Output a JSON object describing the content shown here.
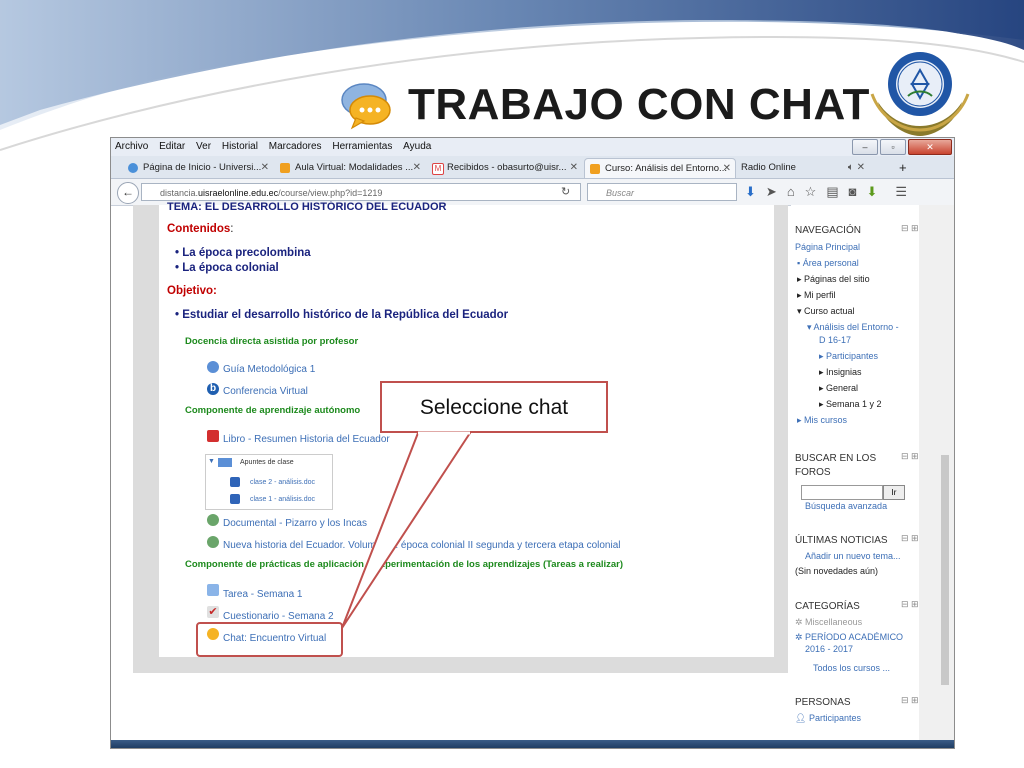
{
  "slide": {
    "title": "TRABAJO CON CHAT"
  },
  "colors": {
    "accent_blue": "#1565c0",
    "callout_border": "#c0504d",
    "heading_red": "#c00000",
    "heading_navy": "#1a237e",
    "section_green": "#1d8a1d",
    "link_blue": "#3d6fb6"
  },
  "browser": {
    "menu": [
      "Archivo",
      "Editar",
      "Ver",
      "Historial",
      "Marcadores",
      "Herramientas",
      "Ayuda"
    ],
    "tabs": [
      {
        "label": "Página de Inicio - Universi...",
        "icon": "globe-icon"
      },
      {
        "label": "Aula Virtual: Modalidades ...",
        "icon": "moodle-icon"
      },
      {
        "label": "Recibidos - obasurto@uisr...",
        "icon": "gmail-icon"
      },
      {
        "label": "Curso: Análisis del Entorno...",
        "icon": "moodle-icon",
        "active": true
      },
      {
        "label": "Radio Online",
        "icon": "speaker-icon"
      }
    ],
    "url_prefix": "distancia.",
    "url_domain": "uisraelonline.edu.ec",
    "url_path": "/course/view.php?id=1219",
    "search_placeholder": "Buscar"
  },
  "course": {
    "topic_cut": "TEMA: EL DESARROLLO HISTÓRICO DEL ECUADOR",
    "contents_label": "Contenidos",
    "contents": [
      "La época precolombina",
      "La época colonial"
    ],
    "objective_label": "Objetivo:",
    "objective": "Estudiar el desarrollo histórico de la República del Ecuador",
    "section1": "Docencia directa asistida por profesor",
    "section1_items": [
      "Guía Metodológica 1",
      "Conferencia Virtual"
    ],
    "section2": "Componente  de aprendizaje autónomo",
    "section2_items": [
      "Libro - Resumen Historia del Ecuador"
    ],
    "folder": {
      "name": "Apuntes de clase",
      "files": [
        "clase 2 - análisis.doc",
        "clase 1 - análisis.doc"
      ]
    },
    "section2_more": [
      "Documental - Pizarro y los Incas",
      "Nueva historia del Ecuador. Volumen 4: época colonial II segunda y tercera etapa colonial"
    ],
    "section3": "Componente de prácticas de aplicación y experimentación de los aprendizajes (Tareas a realizar)",
    "section3_items": [
      "Tarea - Semana 1",
      "Cuestionario - Semana 2",
      "Chat: Encuentro Virtual"
    ]
  },
  "sidebar": {
    "nav_title": "NAVEGACIÓN",
    "nav_home": "Página Principal",
    "nav_items": [
      "Área personal",
      "Páginas del sitio",
      "Mi perfil",
      "Curso actual"
    ],
    "course_name_1": "Análisis del Entorno -",
    "course_name_2": "D 16-17",
    "course_sub": [
      "Participantes",
      "Insignias",
      "General",
      "Semana 1 y 2"
    ],
    "my_courses": "Mis cursos",
    "forum_title_1": "BUSCAR EN LOS",
    "forum_title_2": "FOROS",
    "forum_go": "Ir",
    "forum_adv": "Búsqueda avanzada",
    "news_title": "ÚLTIMAS NOTICIAS",
    "news_add": "Añadir un nuevo tema...",
    "news_none": "(Sin novedades aún)",
    "cat_title": "CATEGORÍAS",
    "cat_misc": "Miscellaneous",
    "cat_period_1": "PERÍODO ACADÉMICO",
    "cat_period_2": "2016 - 2017",
    "cat_all": "Todos los cursos ...",
    "people_title": "PERSONAS",
    "people_part": "Participantes"
  },
  "callout": {
    "text": "Seleccione chat"
  }
}
